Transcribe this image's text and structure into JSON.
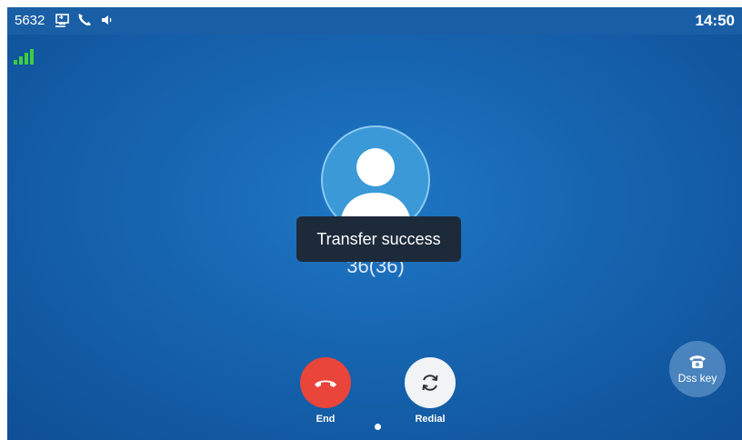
{
  "status_bar": {
    "extension": "5632",
    "time": "14:50",
    "icons": [
      "transfer-status-icon",
      "phone-icon",
      "speaker-icon",
      "signal-icon"
    ]
  },
  "call": {
    "contact": "36(36)",
    "toast": "Transfer success"
  },
  "buttons": {
    "end_label": "End",
    "redial_label": "Redial",
    "dss_label": "Dss key"
  },
  "colors": {
    "end_button": "#e9453b",
    "background": "#1766b2",
    "signal": "#3ecf3e"
  }
}
